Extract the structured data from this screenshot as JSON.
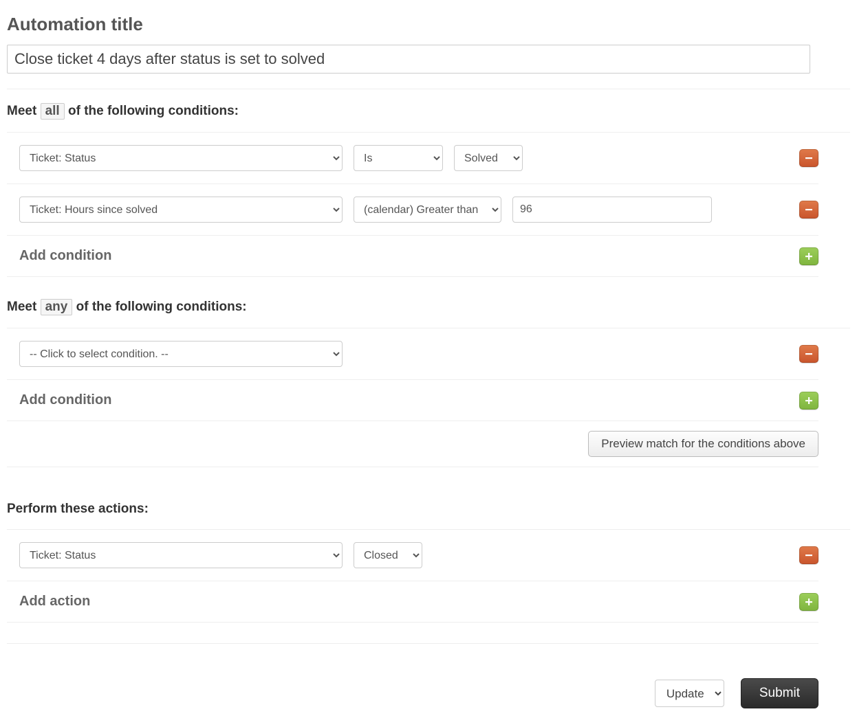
{
  "title_label": "Automation title",
  "title_value": "Close ticket 4 days after status is set to solved",
  "all_section": {
    "prefix": "Meet ",
    "qualifier": "all",
    "suffix": " of the following conditions:",
    "conditions": [
      {
        "field": "Ticket: Status",
        "operator": "Is",
        "value_select": "Solved"
      },
      {
        "field": "Ticket: Hours since solved",
        "operator": "(calendar) Greater than",
        "value_input": "96"
      }
    ],
    "add_label": "Add condition"
  },
  "any_section": {
    "prefix": "Meet ",
    "qualifier": "any",
    "suffix": " of the following conditions:",
    "conditions": [
      {
        "field": "-- Click to select condition. --"
      }
    ],
    "add_label": "Add condition"
  },
  "preview_button": "Preview match for the conditions above",
  "actions_section": {
    "header": "Perform these actions:",
    "actions": [
      {
        "field": "Ticket: Status",
        "value_select": "Closed"
      }
    ],
    "add_label": "Add action"
  },
  "footer": {
    "mode": "Update",
    "submit": "Submit"
  }
}
